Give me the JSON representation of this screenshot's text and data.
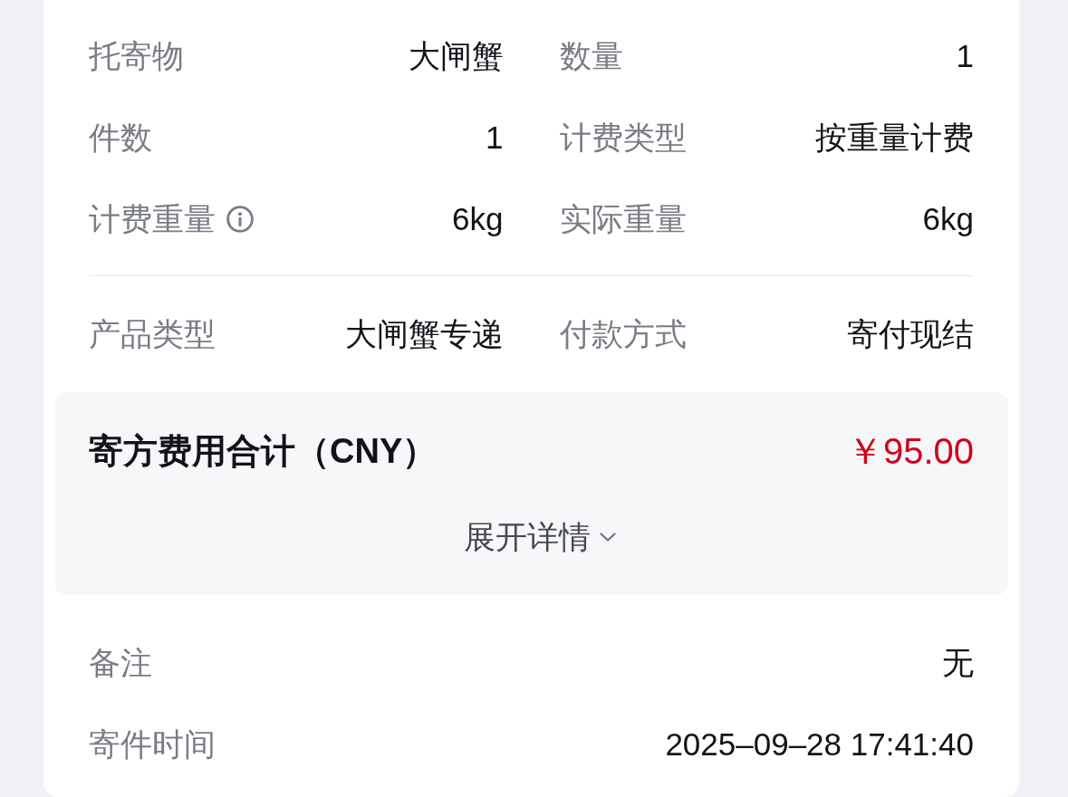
{
  "cargo_details": [
    {
      "label": "托寄物",
      "value": "大闸蟹",
      "info_icon": false
    },
    {
      "label": "数量",
      "value": "1",
      "info_icon": false
    },
    {
      "label": "件数",
      "value": "1",
      "info_icon": false
    },
    {
      "label": "计费类型",
      "value": "按重量计费",
      "info_icon": false
    },
    {
      "label": "计费重量",
      "value": "6kg",
      "info_icon": true
    },
    {
      "label": "实际重量",
      "value": "6kg",
      "info_icon": false
    }
  ],
  "service_details": [
    {
      "label": "产品类型",
      "value": "大闸蟹专递"
    },
    {
      "label": "付款方式",
      "value": "寄付现结"
    }
  ],
  "fee_summary": {
    "title": "寄方费用合计（CNY）",
    "amount": "￥95.00",
    "toggle": {
      "label": "展开详情",
      "expanded": false
    }
  },
  "extra_details": [
    {
      "label": "备注",
      "value": "无"
    },
    {
      "label": "寄件时间",
      "value": "2025–09–28 17:41:40"
    }
  ]
}
